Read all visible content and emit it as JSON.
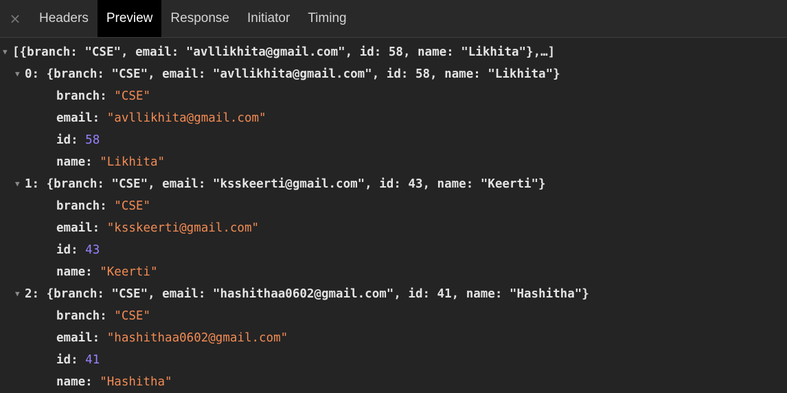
{
  "close_glyph": "×",
  "tabs": [
    {
      "label": "Headers"
    },
    {
      "label": "Preview"
    },
    {
      "label": "Response"
    },
    {
      "label": "Initiator"
    },
    {
      "label": "Timing"
    }
  ],
  "active_tab": "Preview",
  "arrow_glyph": "▼",
  "root_summary": "[{branch: \"CSE\", email: \"avllikhita@gmail.com\", id: 58, name: \"Likhita\"},…]",
  "items": [
    {
      "summary": "0: {branch: \"CSE\", email: \"avllikhita@gmail.com\", id: 58, name: \"Likhita\"}",
      "branch": "\"CSE\"",
      "email": "\"avllikhita@gmail.com\"",
      "id": "58",
      "name": "\"Likhita\""
    },
    {
      "summary": "1: {branch: \"CSE\", email: \"ksskeerti@gmail.com\", id: 43, name: \"Keerti\"}",
      "branch": "\"CSE\"",
      "email": "\"ksskeerti@gmail.com\"",
      "id": "43",
      "name": "\"Keerti\""
    },
    {
      "summary": "2: {branch: \"CSE\", email: \"hashithaa0602@gmail.com\", id: 41, name: \"Hashitha\"}",
      "branch": "\"CSE\"",
      "email": "\"hashithaa0602@gmail.com\"",
      "id": "41",
      "name": "\"Hashitha\""
    }
  ],
  "keys": {
    "branch": "branch: ",
    "email": "email: ",
    "id": "id: ",
    "name": "name: "
  },
  "colors": {
    "string": "#f28b54",
    "number": "#9980ff",
    "background": "#242424"
  }
}
